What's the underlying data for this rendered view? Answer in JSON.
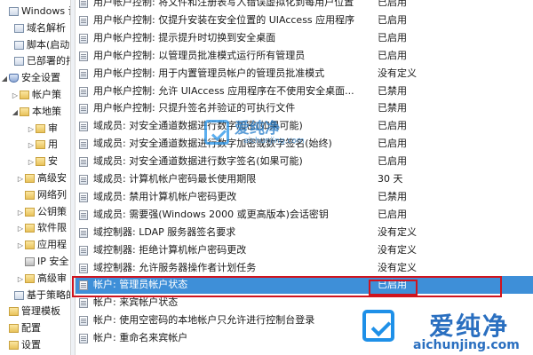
{
  "tree": {
    "nodes": [
      {
        "label": "Windows 设",
        "expander": "",
        "icon": "doc"
      },
      {
        "label": "域名解析",
        "expander": "",
        "icon": "doc"
      },
      {
        "label": "脚本(启动",
        "expander": "",
        "icon": "doc"
      },
      {
        "label": "已部署的打",
        "expander": "",
        "icon": "doc"
      },
      {
        "label": "安全设置",
        "expander": "◢",
        "icon": "shield"
      },
      {
        "label": "帐户策",
        "expander": "▷",
        "icon": "folder"
      },
      {
        "label": "本地策",
        "expander": "◢",
        "icon": "folder"
      },
      {
        "label": "审",
        "expander": "▷",
        "icon": "folder"
      },
      {
        "label": "用",
        "expander": "▷",
        "icon": "folder"
      },
      {
        "label": "安",
        "expander": "▷",
        "icon": "folder"
      },
      {
        "label": "高级安",
        "expander": "▷",
        "icon": "folder"
      },
      {
        "label": "网络列",
        "expander": "",
        "icon": "folder"
      },
      {
        "label": "公钥策",
        "expander": "▷",
        "icon": "folder"
      },
      {
        "label": "软件限",
        "expander": "▷",
        "icon": "folder"
      },
      {
        "label": "应用程",
        "expander": "▷",
        "icon": "folder"
      },
      {
        "label": "IP 安全",
        "expander": "",
        "icon": "lock"
      },
      {
        "label": "高级审",
        "expander": "▷",
        "icon": "folder"
      },
      {
        "label": "基于策略的",
        "expander": "",
        "icon": "doc"
      },
      {
        "label": "管理模板",
        "expander": "",
        "icon": "folder"
      },
      {
        "label": "配置",
        "expander": "",
        "icon": "folder"
      },
      {
        "label": "设置",
        "expander": "",
        "icon": "folder"
      }
    ]
  },
  "policies": [
    {
      "name": "用户帐户控制: 将文件和注册表写入错误虚拟化到每用户位置",
      "setting": "已启用",
      "selected": false
    },
    {
      "name": "用户帐户控制: 仅提升安装在安全位置的 UIAccess 应用程序",
      "setting": "已启用",
      "selected": false
    },
    {
      "name": "用户帐户控制: 提示提升时切换到安全桌面",
      "setting": "已启用",
      "selected": false
    },
    {
      "name": "用户帐户控制: 以管理员批准模式运行所有管理员",
      "setting": "已启用",
      "selected": false
    },
    {
      "name": "用户帐户控制: 用于内置管理员帐户的管理员批准模式",
      "setting": "没有定义",
      "selected": false
    },
    {
      "name": "用户帐户控制: 允许 UIAccess 应用程序在不使用安全桌面...",
      "setting": "已禁用",
      "selected": false
    },
    {
      "name": "用户帐户控制: 只提升签名并验证的可执行文件",
      "setting": "已禁用",
      "selected": false
    },
    {
      "name": "域成员: 对安全通道数据进行数字加密(如果可能)",
      "setting": "已启用",
      "selected": false
    },
    {
      "name": "域成员: 对安全通道数据进行数字加密或数字签名(始终)",
      "setting": "已启用",
      "selected": false
    },
    {
      "name": "域成员: 对安全通道数据进行数字签名(如果可能)",
      "setting": "已启用",
      "selected": false
    },
    {
      "name": "域成员: 计算机帐户密码最长使用期限",
      "setting": "30 天",
      "selected": false
    },
    {
      "name": "域成员: 禁用计算机帐户密码更改",
      "setting": "已禁用",
      "selected": false
    },
    {
      "name": "域成员: 需要强(Windows 2000 或更高版本)会话密钥",
      "setting": "已启用",
      "selected": false
    },
    {
      "name": "域控制器: LDAP 服务器签名要求",
      "setting": "没有定义",
      "selected": false
    },
    {
      "name": "域控制器: 拒绝计算机帐户密码更改",
      "setting": "没有定义",
      "selected": false
    },
    {
      "name": "域控制器: 允许服务器操作者计划任务",
      "setting": "没有定义",
      "selected": false
    },
    {
      "name": "帐户: 管理员帐户状态",
      "setting": "已启用",
      "selected": true
    },
    {
      "name": "帐户: 来宾帐户状态",
      "setting": "",
      "selected": false
    },
    {
      "name": "帐户: 使用空密码的本地帐户只允许进行控制台登录",
      "setting": "",
      "selected": false
    },
    {
      "name": "帐户: 重命名来宾帐户",
      "setting": "",
      "selected": false
    }
  ],
  "watermark_center": {
    "brand": "爱纯净",
    "sub": "aichunjing.com"
  },
  "watermark_corner": {
    "brand": "爱纯净",
    "url": "aichunjing.com"
  },
  "colors": {
    "selection": "#3e8fd8",
    "highlight_box": "#d0141e",
    "watermark": "#1e90e8"
  }
}
